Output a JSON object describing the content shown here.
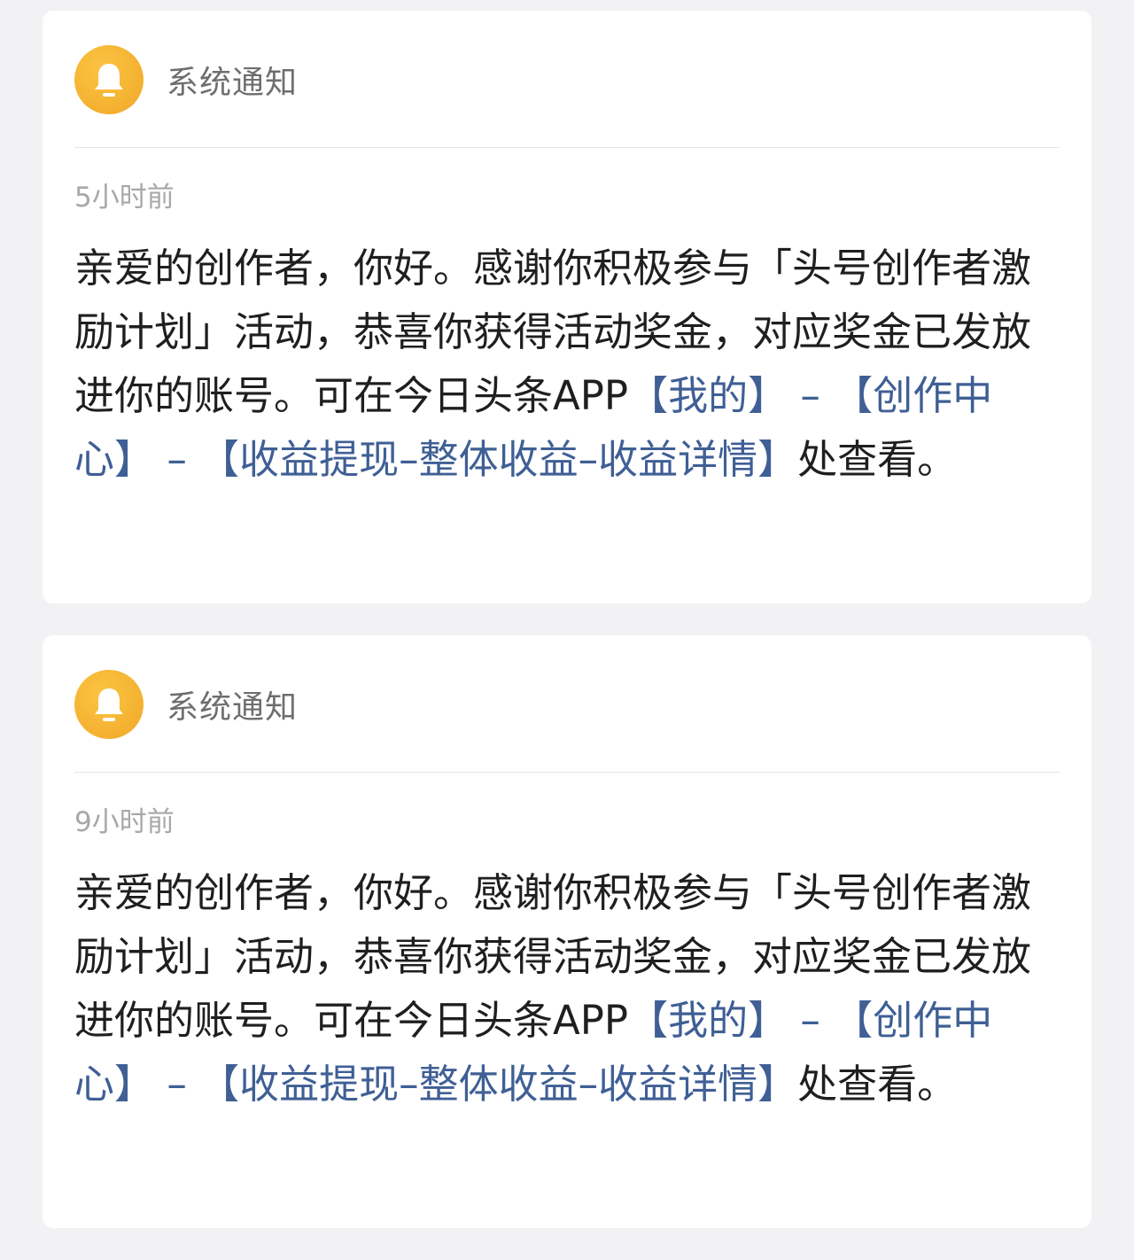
{
  "notifications": [
    {
      "sender": "系统通知",
      "time": "5小时前",
      "text_before": "亲爱的创作者，你好。感谢你积极参与「头号创作者激励计划」活动，恭喜你获得活动奖金，对应奖金已发放进你的账号。可在今日头条APP",
      "link_mine": "【我的】",
      "sep1": " – ",
      "link_creator_center": "【创作中心】",
      "sep2": " – ",
      "link_earnings": "【收益提现–整体收益–收益详情】",
      "text_after": "处查看。"
    },
    {
      "sender": "系统通知",
      "time": "9小时前",
      "text_before": "亲爱的创作者，你好。感谢你积极参与「头号创作者激励计划」活动，恭喜你获得活动奖金，对应奖金已发放进你的账号。可在今日头条APP",
      "link_mine": "【我的】",
      "sep1": " – ",
      "link_creator_center": "【创作中心】",
      "sep2": " – ",
      "link_earnings": "【收益提现–整体收益–收益详情】",
      "text_after": "处查看。"
    }
  ],
  "colors": {
    "background": "#f2f2f4",
    "card": "#ffffff",
    "avatar": "#f4b030",
    "link": "#3f5f95",
    "body_text": "#1f1f1f",
    "sender_text": "#6e6e6e",
    "time_text": "#a8a8aa"
  },
  "icons": {
    "avatar": "bell-icon"
  }
}
